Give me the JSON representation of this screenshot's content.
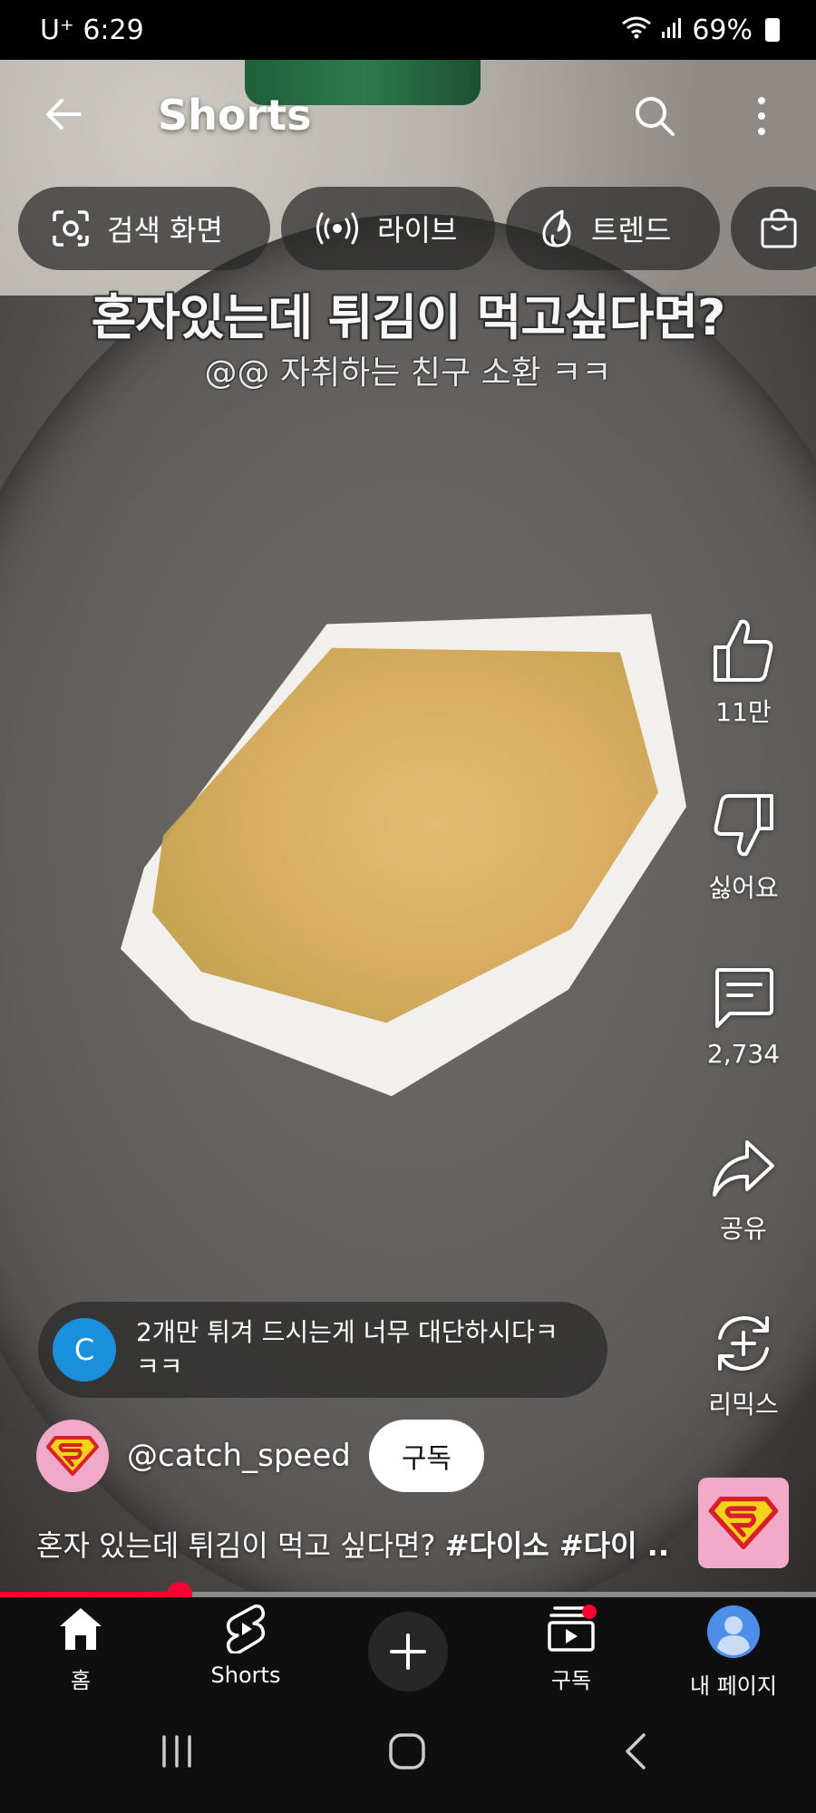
{
  "status_bar": {
    "carrier_time": "U⁺ 6:29",
    "battery": "69%"
  },
  "app_bar": {
    "title": "Shorts"
  },
  "chips": [
    {
      "label": "검색 화면",
      "icon": "lens-icon"
    },
    {
      "label": "라이브",
      "icon": "live-icon"
    },
    {
      "label": "트렌드",
      "icon": "flame-icon"
    },
    {
      "label": "",
      "icon": "shopping-bag-icon"
    }
  ],
  "video": {
    "caption_main": "혼자있는데 튀김이 먹고싶다면?",
    "caption_sub": "@@ 자취하는 친구 소환 ㅋㅋ"
  },
  "actions": {
    "like_count": "11만",
    "dislike_label": "싫어요",
    "comment_count": "2,734",
    "share_label": "공유",
    "remix_label": "리믹스"
  },
  "top_comment": {
    "avatar_letter": "C",
    "avatar_color": "#1a8fdb",
    "text": "2개만 튀겨 드시는게 너무 대단하시다ㅋㅋㅋ"
  },
  "channel": {
    "handle": "@catch_speed",
    "subscribe_label": "구독"
  },
  "description": {
    "text": "혼자 있는데 튀김이 먹고 싶다면? ",
    "tags": "#다이소 #다이 ..."
  },
  "progress": {
    "fraction": 0.22,
    "color": "#ff0033"
  },
  "bottom_nav": {
    "home": "홈",
    "shorts": "Shorts",
    "subscriptions": "구독",
    "you": "내 페이지"
  }
}
